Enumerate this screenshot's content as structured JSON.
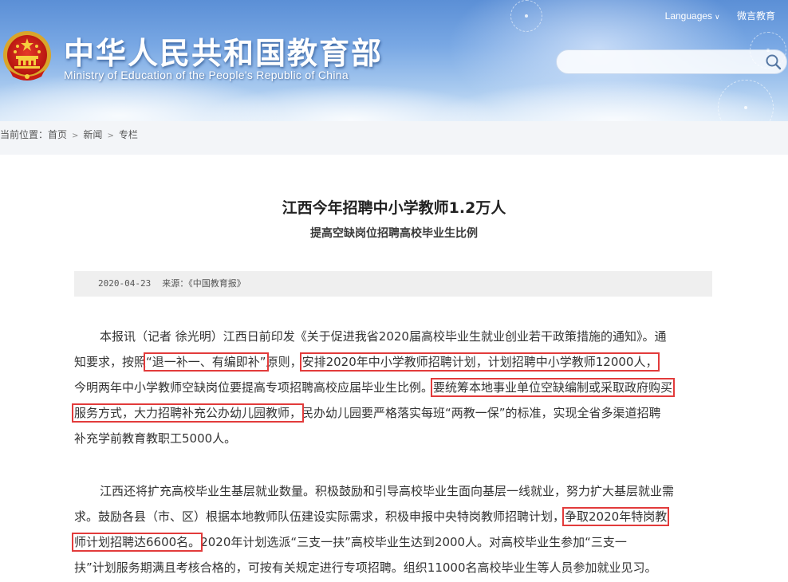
{
  "header": {
    "logo_cn": "中华人民共和国教育部",
    "logo_en": "Ministry of Education of the People's Republic of China",
    "languages": "Languages",
    "weibo": "微言教育",
    "search_placeholder": ""
  },
  "breadcrumb": {
    "label": "当前位置：",
    "items": [
      "首页",
      "新闻",
      "专栏"
    ]
  },
  "article": {
    "title": "江西今年招聘中小学教师1.2万人",
    "subtitle": "提高空缺岗位招聘高校毕业生比例",
    "date": "2020-04-23",
    "source": "来源：《中国教育报》",
    "p1": {
      "l1": "本报讯（记者 徐光明）江西日前印发《关于促进我省2020届高校毕业生就业创业若干政策措施的通知》。通",
      "l2a": "知要求，按照",
      "l2b": "“退一补一、有编即补”",
      "l2c": "原则，",
      "l2d": "安排2020年中小学教师招聘计划，计划招聘中小学教师12000人，",
      "l3a": "今明两年中小学教师空缺岗位要提高专项招聘高校应届毕业生比例。",
      "l3b": "要统筹本地事业单位空缺编制或采取政府购买",
      "l4a": "服务方式，大力招聘补充公办幼儿园教师，",
      "l4b": "民办幼儿园要严格落实每班“两教一保”的标准，实现全省多渠道招聘",
      "l5": "补充学前教育教职工5000人。"
    },
    "p2": {
      "l1": "江西还将扩充高校毕业生基层就业数量。积极鼓励和引导高校毕业生面向基层一线就业，努力扩大基层就业需",
      "l2a": "求。鼓励各县（市、区）根据本地教师队伍建设实际需求，积极申报中央特岗教师招聘计划，",
      "l2b": "争取2020年特岗教",
      "l3a": "师计划招聘达6600名。",
      "l3b": "2020年计划选派“三支一扶”高校毕业生达到2000人。对高校毕业生参加“三支一",
      "l4": "扶”计划服务期满且考核合格的，可按有关规定进行专项招聘。组织11000名高校毕业生等人员参加就业见习。"
    }
  },
  "colors": {
    "highlight": "#e23b3b",
    "header_blue": "#5b8fd6"
  }
}
